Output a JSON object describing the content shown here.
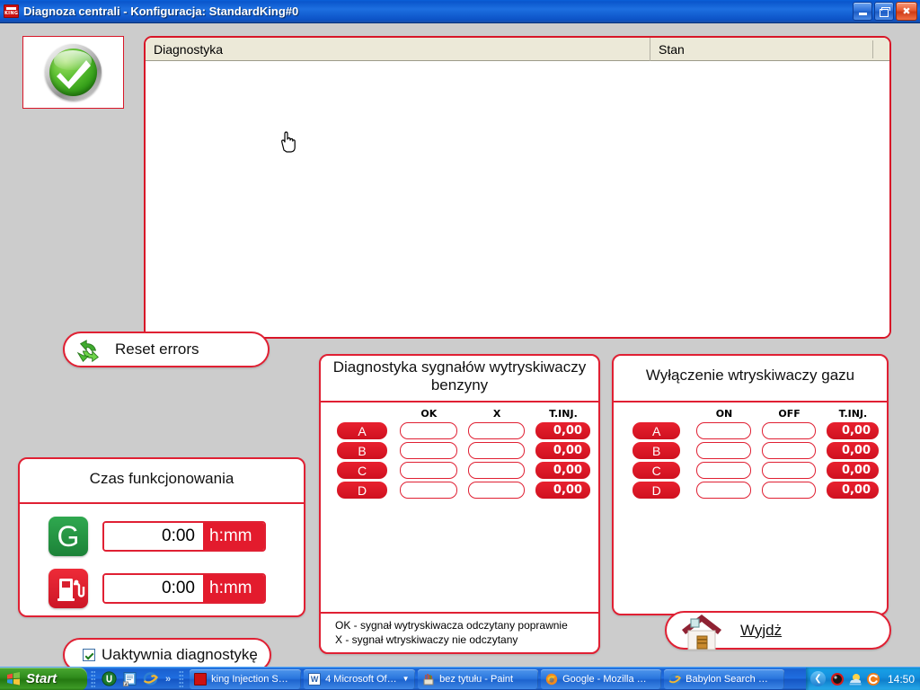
{
  "window": {
    "title": "Diagnoza centrali - Konfiguracja: StandardKing#0",
    "app_icon": "king-logo-icon",
    "minimize_label": "_",
    "restore_label": "❐",
    "close_label": "✕"
  },
  "status": {
    "icon": "green-check-badge-icon"
  },
  "list": {
    "columns": [
      "Diagnostyka",
      "Stan"
    ],
    "rows": []
  },
  "reset": {
    "label": "Reset errors",
    "icon": "recycle-arrows-icon"
  },
  "time_panel": {
    "title": "Czas funkcjonowania",
    "rows": [
      {
        "icon": "gas-g-badge-icon",
        "value": "0:00",
        "unit": "h:mm"
      },
      {
        "icon": "fuel-pump-badge-icon",
        "value": "0:00",
        "unit": "h:mm"
      }
    ]
  },
  "diag_checkbox": {
    "label": "Uaktywnia diagnostykę",
    "checked": true
  },
  "petrol_panel": {
    "title": "Diagnostyka sygnałów wytryskiwaczy benzyny",
    "headers": [
      "",
      "OK",
      "X",
      "T.INJ."
    ],
    "rows": [
      {
        "name": "A",
        "ok": "",
        "x": "",
        "tinj": "0,00"
      },
      {
        "name": "B",
        "ok": "",
        "x": "",
        "tinj": "0,00"
      },
      {
        "name": "C",
        "ok": "",
        "x": "",
        "tinj": "0,00"
      },
      {
        "name": "D",
        "ok": "",
        "x": "",
        "tinj": "0,00"
      }
    ],
    "legend": [
      "OK - sygnał wytryskiwacza odczytany poprawnie",
      "X - sygnał wtryskiwaczy nie odczytany"
    ]
  },
  "gas_panel": {
    "title": "Wyłączenie wtryskiwaczy gazu",
    "headers": [
      "",
      "ON",
      "OFF",
      "T.INJ."
    ],
    "rows": [
      {
        "name": "A",
        "on": "",
        "off": "",
        "tinj": "0,00"
      },
      {
        "name": "B",
        "on": "",
        "off": "",
        "tinj": "0,00"
      },
      {
        "name": "C",
        "on": "",
        "off": "",
        "tinj": "0,00"
      },
      {
        "name": "D",
        "on": "",
        "off": "",
        "tinj": "0,00"
      }
    ]
  },
  "exit": {
    "label_accel": "W",
    "label_rest": "yjdż",
    "icon": "house-icon"
  },
  "taskbar": {
    "start_label": "Start",
    "quicklaunch": [
      "utorrent-icon",
      "notepad-shortcut-icon",
      "internet-explorer-icon"
    ],
    "quicklaunch_more": "»",
    "tasks": [
      {
        "icon": "king-logo-icon",
        "label": "king Injection S…",
        "has_arrow": false
      },
      {
        "icon": "word-icon",
        "label": "4 Microsoft Of…",
        "has_arrow": true
      },
      {
        "icon": "paint-icon",
        "label": "bez tytułu - Paint",
        "has_arrow": false
      },
      {
        "icon": "firefox-icon",
        "label": "Google - Mozilla …",
        "has_arrow": false
      },
      {
        "icon": "internet-explorer-icon",
        "label": "Babylon Search …",
        "has_arrow": false
      }
    ],
    "tray_expand": "❮",
    "tray_icons": [
      "black-ball-icon",
      "weather-sun-icon",
      "orange-refresh-icon"
    ],
    "clock": "14:50"
  },
  "colors": {
    "accent_red": "#e02033",
    "panel_bg": "#ffffff",
    "desktop_bg": "#cccccc",
    "titlebar_blue": "#0c52c6",
    "ok_green": "#2f9a16"
  }
}
